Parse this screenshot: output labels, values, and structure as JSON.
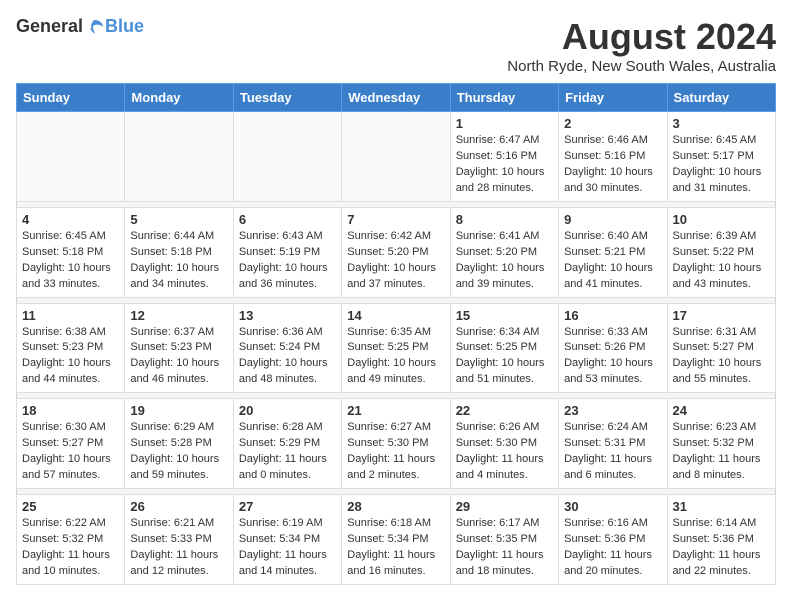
{
  "header": {
    "logo_general": "General",
    "logo_blue": "Blue",
    "month_title": "August 2024",
    "location": "North Ryde, New South Wales, Australia"
  },
  "weekdays": [
    "Sunday",
    "Monday",
    "Tuesday",
    "Wednesday",
    "Thursday",
    "Friday",
    "Saturday"
  ],
  "weeks": [
    [
      {
        "day": "",
        "info": ""
      },
      {
        "day": "",
        "info": ""
      },
      {
        "day": "",
        "info": ""
      },
      {
        "day": "",
        "info": ""
      },
      {
        "day": "1",
        "info": "Sunrise: 6:47 AM\nSunset: 5:16 PM\nDaylight: 10 hours\nand 28 minutes."
      },
      {
        "day": "2",
        "info": "Sunrise: 6:46 AM\nSunset: 5:16 PM\nDaylight: 10 hours\nand 30 minutes."
      },
      {
        "day": "3",
        "info": "Sunrise: 6:45 AM\nSunset: 5:17 PM\nDaylight: 10 hours\nand 31 minutes."
      }
    ],
    [
      {
        "day": "4",
        "info": "Sunrise: 6:45 AM\nSunset: 5:18 PM\nDaylight: 10 hours\nand 33 minutes."
      },
      {
        "day": "5",
        "info": "Sunrise: 6:44 AM\nSunset: 5:18 PM\nDaylight: 10 hours\nand 34 minutes."
      },
      {
        "day": "6",
        "info": "Sunrise: 6:43 AM\nSunset: 5:19 PM\nDaylight: 10 hours\nand 36 minutes."
      },
      {
        "day": "7",
        "info": "Sunrise: 6:42 AM\nSunset: 5:20 PM\nDaylight: 10 hours\nand 37 minutes."
      },
      {
        "day": "8",
        "info": "Sunrise: 6:41 AM\nSunset: 5:20 PM\nDaylight: 10 hours\nand 39 minutes."
      },
      {
        "day": "9",
        "info": "Sunrise: 6:40 AM\nSunset: 5:21 PM\nDaylight: 10 hours\nand 41 minutes."
      },
      {
        "day": "10",
        "info": "Sunrise: 6:39 AM\nSunset: 5:22 PM\nDaylight: 10 hours\nand 43 minutes."
      }
    ],
    [
      {
        "day": "11",
        "info": "Sunrise: 6:38 AM\nSunset: 5:23 PM\nDaylight: 10 hours\nand 44 minutes."
      },
      {
        "day": "12",
        "info": "Sunrise: 6:37 AM\nSunset: 5:23 PM\nDaylight: 10 hours\nand 46 minutes."
      },
      {
        "day": "13",
        "info": "Sunrise: 6:36 AM\nSunset: 5:24 PM\nDaylight: 10 hours\nand 48 minutes."
      },
      {
        "day": "14",
        "info": "Sunrise: 6:35 AM\nSunset: 5:25 PM\nDaylight: 10 hours\nand 49 minutes."
      },
      {
        "day": "15",
        "info": "Sunrise: 6:34 AM\nSunset: 5:25 PM\nDaylight: 10 hours\nand 51 minutes."
      },
      {
        "day": "16",
        "info": "Sunrise: 6:33 AM\nSunset: 5:26 PM\nDaylight: 10 hours\nand 53 minutes."
      },
      {
        "day": "17",
        "info": "Sunrise: 6:31 AM\nSunset: 5:27 PM\nDaylight: 10 hours\nand 55 minutes."
      }
    ],
    [
      {
        "day": "18",
        "info": "Sunrise: 6:30 AM\nSunset: 5:27 PM\nDaylight: 10 hours\nand 57 minutes."
      },
      {
        "day": "19",
        "info": "Sunrise: 6:29 AM\nSunset: 5:28 PM\nDaylight: 10 hours\nand 59 minutes."
      },
      {
        "day": "20",
        "info": "Sunrise: 6:28 AM\nSunset: 5:29 PM\nDaylight: 11 hours\nand 0 minutes."
      },
      {
        "day": "21",
        "info": "Sunrise: 6:27 AM\nSunset: 5:30 PM\nDaylight: 11 hours\nand 2 minutes."
      },
      {
        "day": "22",
        "info": "Sunrise: 6:26 AM\nSunset: 5:30 PM\nDaylight: 11 hours\nand 4 minutes."
      },
      {
        "day": "23",
        "info": "Sunrise: 6:24 AM\nSunset: 5:31 PM\nDaylight: 11 hours\nand 6 minutes."
      },
      {
        "day": "24",
        "info": "Sunrise: 6:23 AM\nSunset: 5:32 PM\nDaylight: 11 hours\nand 8 minutes."
      }
    ],
    [
      {
        "day": "25",
        "info": "Sunrise: 6:22 AM\nSunset: 5:32 PM\nDaylight: 11 hours\nand 10 minutes."
      },
      {
        "day": "26",
        "info": "Sunrise: 6:21 AM\nSunset: 5:33 PM\nDaylight: 11 hours\nand 12 minutes."
      },
      {
        "day": "27",
        "info": "Sunrise: 6:19 AM\nSunset: 5:34 PM\nDaylight: 11 hours\nand 14 minutes."
      },
      {
        "day": "28",
        "info": "Sunrise: 6:18 AM\nSunset: 5:34 PM\nDaylight: 11 hours\nand 16 minutes."
      },
      {
        "day": "29",
        "info": "Sunrise: 6:17 AM\nSunset: 5:35 PM\nDaylight: 11 hours\nand 18 minutes."
      },
      {
        "day": "30",
        "info": "Sunrise: 6:16 AM\nSunset: 5:36 PM\nDaylight: 11 hours\nand 20 minutes."
      },
      {
        "day": "31",
        "info": "Sunrise: 6:14 AM\nSunset: 5:36 PM\nDaylight: 11 hours\nand 22 minutes."
      }
    ]
  ]
}
